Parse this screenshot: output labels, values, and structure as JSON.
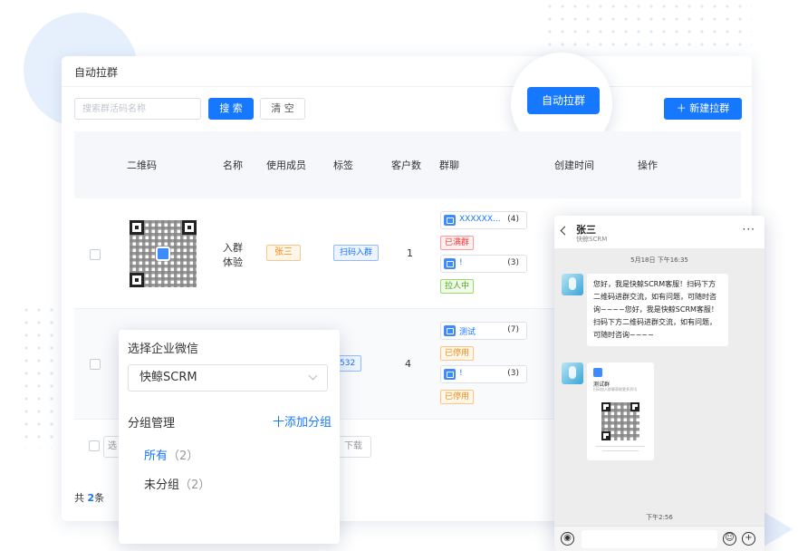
{
  "page": {
    "title": "自动拉群",
    "search_placeholder": "搜索群活码名称",
    "search_label": "搜 索",
    "clear_label": "清 空",
    "new_label": "＋ 新建拉群",
    "highlight_label": "自动拉群"
  },
  "table": {
    "headers": [
      "二维码",
      "名称",
      "使用成员",
      "标签",
      "客户数",
      "群聊",
      "创建时间",
      "操作"
    ],
    "rows": [
      {
        "name": "入群体验",
        "member": "张三",
        "tag": "扫码入群",
        "customers": "1",
        "groups": [
          {
            "name": "XXXXXX...",
            "count": "(4)",
            "status": "已满群"
          },
          {
            "name": "!",
            "count": "(3)",
            "status": "拉人中"
          }
        ]
      },
      {
        "tag_partial": "532",
        "customers": "4",
        "groups": [
          {
            "name": "测试",
            "count": "(7)",
            "status": "已停用"
          },
          {
            "name": "!",
            "count": "(3)",
            "status": "已停用"
          }
        ]
      }
    ]
  },
  "footer": {
    "btn_partial_left": "选",
    "btn_partial_right": "下载",
    "total_prefix": "共 ",
    "total_count": "2",
    "total_suffix": "条"
  },
  "dropdown": {
    "title": "选择企业微信",
    "selected": "快鲸SCRM",
    "group_manage": "分组管理",
    "add_group": "十添加分组",
    "options": [
      {
        "label": "所有",
        "count": "（2）"
      },
      {
        "label": "未分组",
        "count": "（2）"
      }
    ]
  },
  "chat": {
    "name": "张三",
    "subtitle": "快鲸SCRM",
    "more": "···",
    "time1": "5月18日 下午16:35",
    "message": "您好，我是快鲸SCRM客服！扫码下方二维码进群交流，如有问题，可随时咨询~~~~您好，我是快鲸SCRM客服！扫码下方二维码进群交流，如有问题，可随时咨询~~~~",
    "card_title": "测试群",
    "card_sub": "扫码加入群聊获取更多资讯",
    "time2": "下午2:56"
  },
  "colors": {
    "primary": "#1677ff",
    "tag_orange": "#f08a17",
    "status_red": "#ef3b3b",
    "status_green": "#44a316"
  }
}
